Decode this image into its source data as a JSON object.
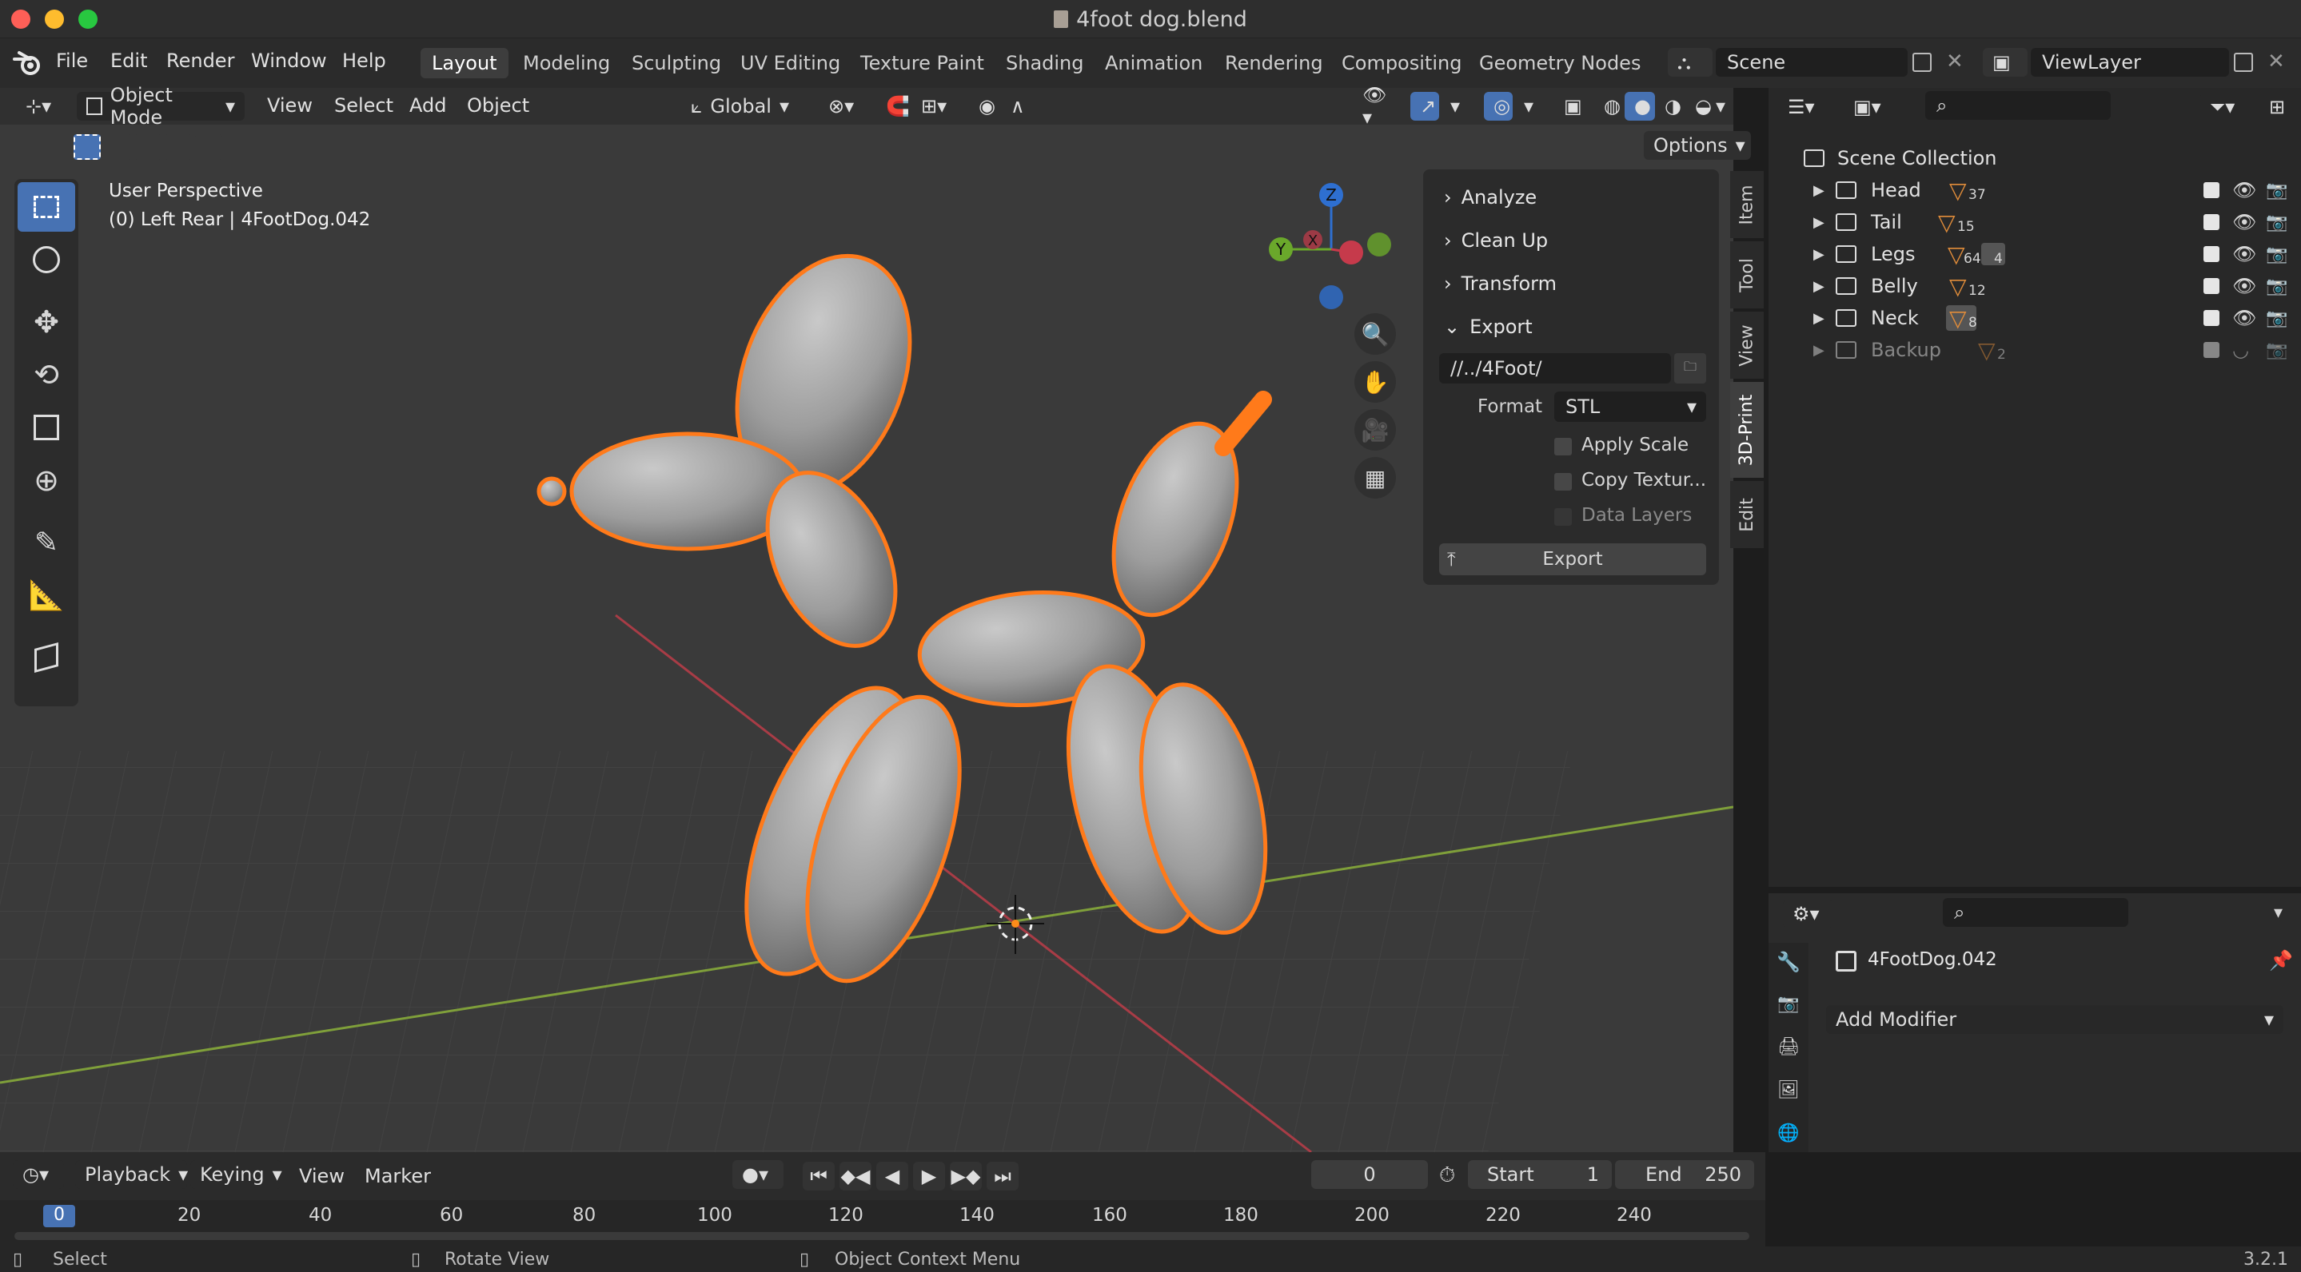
{
  "window": {
    "title": "4foot dog.blend"
  },
  "menubar": {
    "items": [
      "File",
      "Edit",
      "Render",
      "Window",
      "Help"
    ]
  },
  "workspaces": [
    "Layout",
    "Modeling",
    "Sculpting",
    "UV Editing",
    "Texture Paint",
    "Shading",
    "Animation",
    "Rendering",
    "Compositing",
    "Geometry Nodes"
  ],
  "scene": {
    "name": "Scene",
    "view_layer": "ViewLayer"
  },
  "viewport": {
    "header": {
      "mode": "Object Mode",
      "menus": [
        "View",
        "Select",
        "Add",
        "Object"
      ],
      "orientation": "Global",
      "options": "Options"
    },
    "overlay_text": {
      "line1": "User Perspective",
      "line2": "(0) Left Rear | 4FootDog.042"
    },
    "gizmo": {
      "z": "Z",
      "y": "Y",
      "x": "X"
    }
  },
  "npanel": {
    "sections": [
      "Analyze",
      "Clean Up",
      "Transform",
      "Export"
    ],
    "export": {
      "path": "//../4Foot/",
      "format_label": "Format",
      "format_value": "STL",
      "apply_scale": "Apply Scale",
      "copy_textures": "Copy Textur...",
      "data_layers": "Data Layers",
      "export_button": "Export"
    },
    "tabs": [
      "Item",
      "Tool",
      "View",
      "3D-Print",
      "Edit"
    ]
  },
  "outliner": {
    "root": "Scene Collection",
    "collections": [
      {
        "name": "Head",
        "count": "37"
      },
      {
        "name": "Tail",
        "count": "15"
      },
      {
        "name": "Legs",
        "count": "64",
        "extra": "4"
      },
      {
        "name": "Belly",
        "count": "12"
      },
      {
        "name": "Neck",
        "count": "8"
      },
      {
        "name": "Backup",
        "count": "2"
      }
    ]
  },
  "properties": {
    "object_name": "4FootDog.042",
    "add_modifier": "Add Modifier"
  },
  "timeline": {
    "menus": [
      "Playback",
      "Keying",
      "View",
      "Marker"
    ],
    "current_frame": "0",
    "start_label": "Start",
    "start": "1",
    "end_label": "End",
    "end": "250",
    "ruler": [
      "0",
      "20",
      "40",
      "60",
      "80",
      "100",
      "120",
      "140",
      "160",
      "180",
      "200",
      "220",
      "240"
    ]
  },
  "statusbar": {
    "select": "Select",
    "rotate": "Rotate View",
    "context": "Object Context Menu",
    "version": "3.2.1"
  },
  "colors": {
    "accent": "#4772b3",
    "selection": "#ff7a1a",
    "viewport_bg": "#3a3a3a"
  }
}
